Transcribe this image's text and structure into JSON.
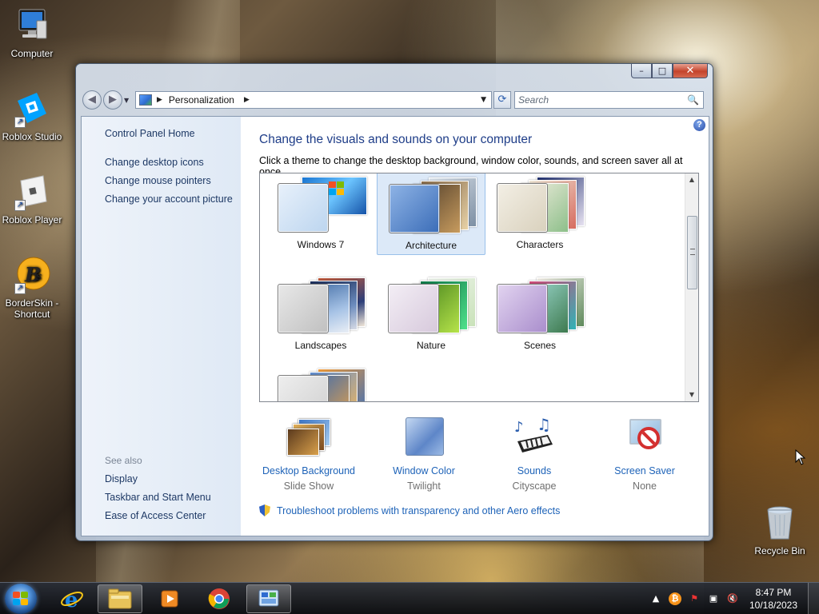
{
  "desktop": {
    "icons": [
      {
        "label": "Computer"
      },
      {
        "label": "Roblox Studio"
      },
      {
        "label": "Roblox Player"
      },
      {
        "label": "BorderSkin - Shortcut"
      },
      {
        "label": "Recycle Bin"
      }
    ]
  },
  "window": {
    "controls": {
      "minimize": "–",
      "maximize": "□",
      "close": "✕"
    },
    "address": {
      "crumb": "Personalization"
    },
    "search": {
      "placeholder": "Search"
    },
    "left_pane": {
      "home": "Control Panel Home",
      "tasks": [
        "Change desktop icons",
        "Change mouse pointers",
        "Change your account picture"
      ],
      "see_also_heading": "See also",
      "see_also": [
        "Display",
        "Taskbar and Start Menu",
        "Ease of Access Center"
      ]
    },
    "main": {
      "title": "Change the visuals and sounds on your computer",
      "subtitle": "Click a theme to change the desktop background, window color, sounds, and screen saver all at once.",
      "themes": [
        {
          "name": "Windows 7",
          "selected": false
        },
        {
          "name": "Architecture",
          "selected": true
        },
        {
          "name": "Characters",
          "selected": false
        },
        {
          "name": "Landscapes",
          "selected": false
        },
        {
          "name": "Nature",
          "selected": false
        },
        {
          "name": "Scenes",
          "selected": false
        }
      ],
      "bottom": [
        {
          "label": "Desktop Background",
          "value": "Slide Show"
        },
        {
          "label": "Window Color",
          "value": "Twilight"
        },
        {
          "label": "Sounds",
          "value": "Cityscape"
        },
        {
          "label": "Screen Saver",
          "value": "None"
        }
      ],
      "aero_link": "Troubleshoot problems with transparency and other Aero effects"
    }
  },
  "taskbar": {
    "clock": {
      "time": "8:47 PM",
      "date": "10/18/2023"
    }
  },
  "colors": {
    "link": "#1e63b8",
    "title": "#1e3d88",
    "selection": "#dce9f8"
  }
}
